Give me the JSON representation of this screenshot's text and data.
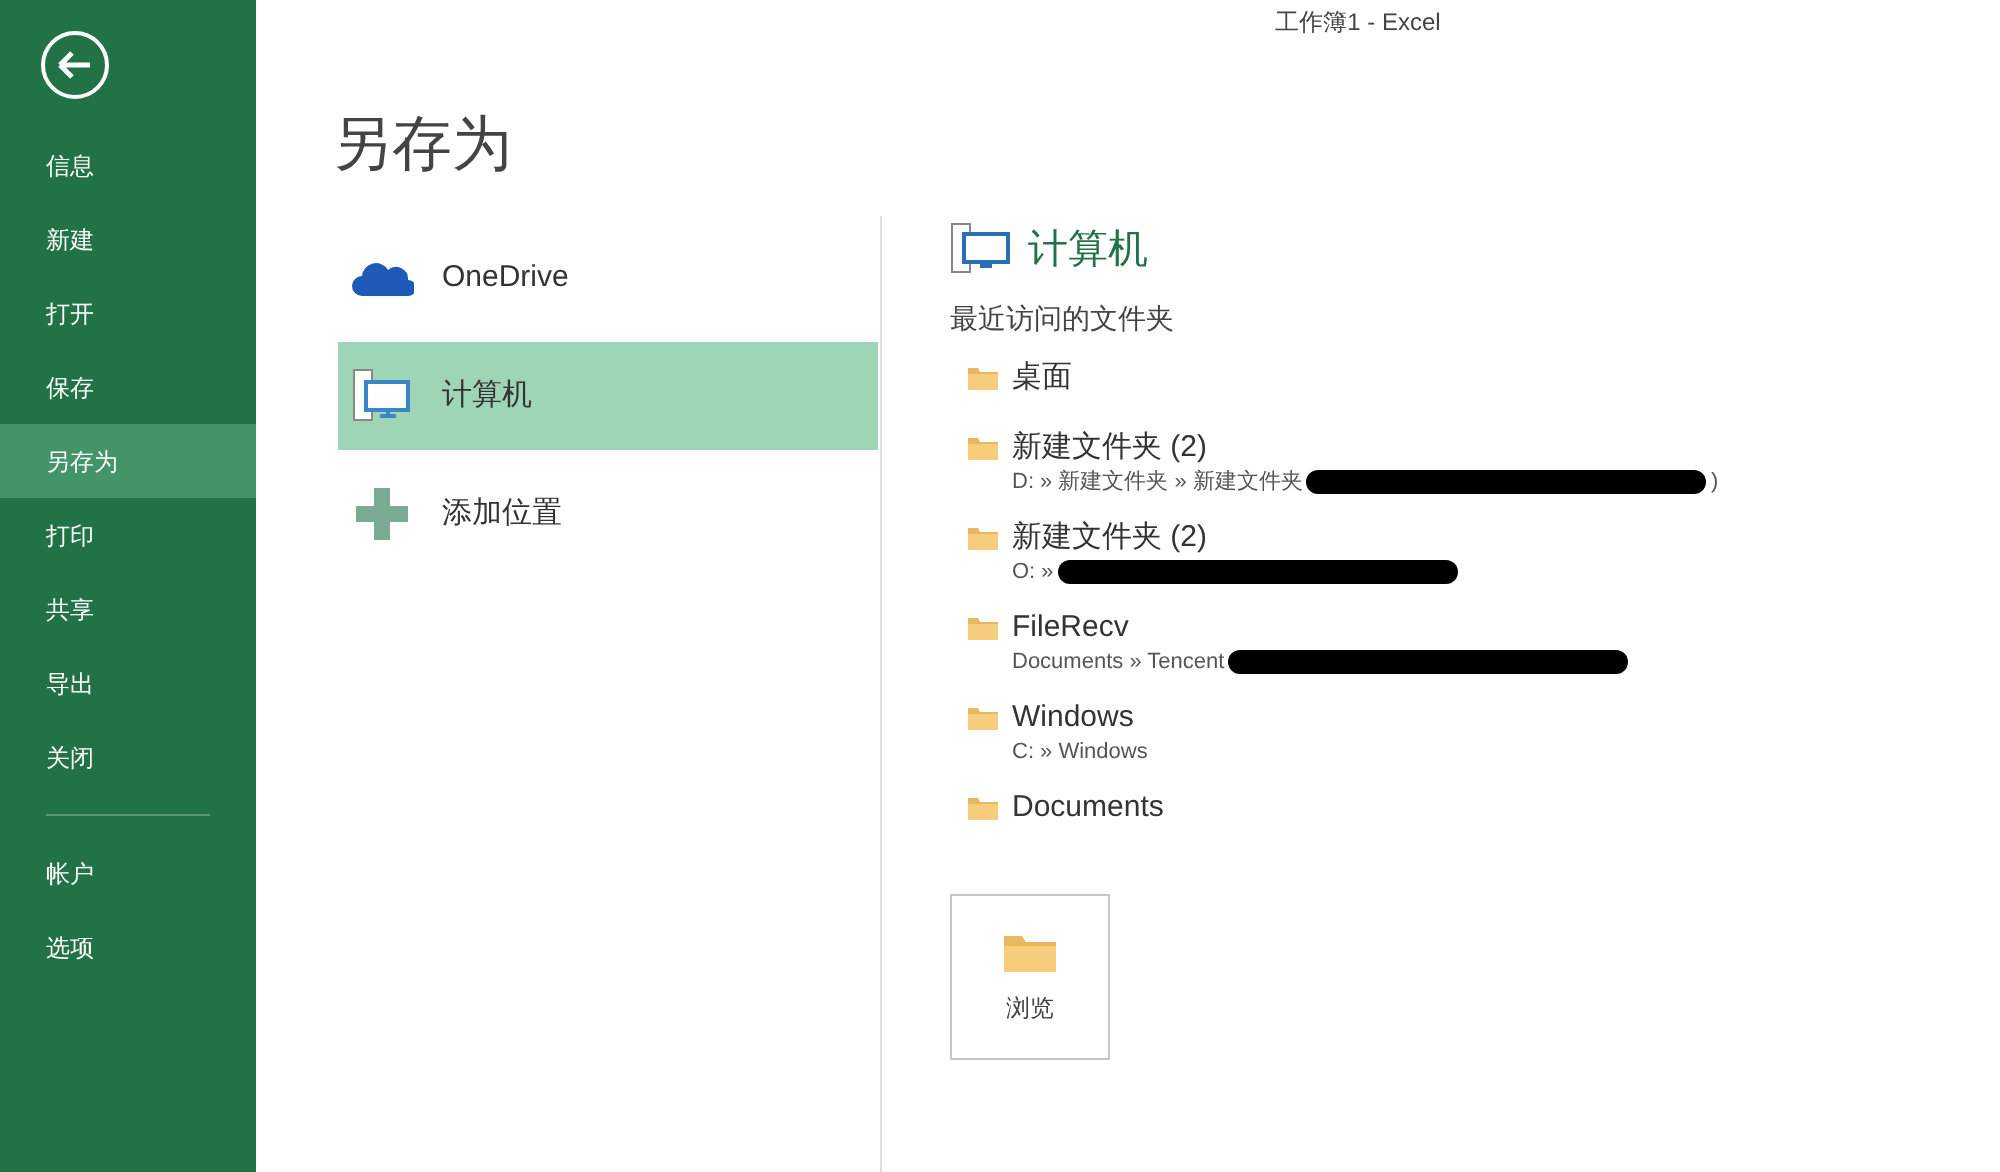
{
  "window": {
    "title": "工作簿1 - Excel"
  },
  "sidebar": {
    "items": [
      {
        "label": "信息",
        "selected": false
      },
      {
        "label": "新建",
        "selected": false
      },
      {
        "label": "打开",
        "selected": false
      },
      {
        "label": "保存",
        "selected": false
      },
      {
        "label": "另存为",
        "selected": true
      },
      {
        "label": "打印",
        "selected": false
      },
      {
        "label": "共享",
        "selected": false
      },
      {
        "label": "导出",
        "selected": false
      },
      {
        "label": "关闭",
        "selected": false
      }
    ],
    "bottom_items": [
      {
        "label": "帐户",
        "selected": false
      },
      {
        "label": "选项",
        "selected": false
      }
    ]
  },
  "page_title": "另存为",
  "places": [
    {
      "kind": "cloud",
      "label": "OneDrive",
      "selected": false
    },
    {
      "kind": "computer",
      "label": "计算机",
      "selected": true
    },
    {
      "kind": "add",
      "label": "添加位置",
      "selected": false
    }
  ],
  "detail": {
    "title": "计算机",
    "section": "最近访问的文件夹",
    "folders": [
      {
        "name": "桌面"
      },
      {
        "name": "新建文件夹 (2)",
        "path": "D: » 新建文件夹 » 新建文件夹",
        "redacted": true,
        "path_end": ")"
      },
      {
        "name": "新建文件夹 (2)",
        "path": "O: »",
        "redacted": true
      },
      {
        "name": "FileRecv",
        "path": "Documents » Tencent",
        "redacted": true
      },
      {
        "name": "Windows",
        "path": "C: » Windows"
      },
      {
        "name": "Documents"
      }
    ],
    "browse": "浏览"
  }
}
